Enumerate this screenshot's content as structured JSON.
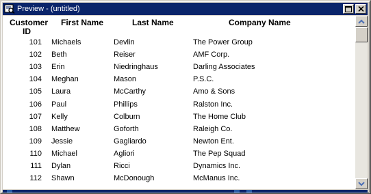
{
  "window": {
    "title": "Preview - (untitled)",
    "app_icon": "preview-icon",
    "buttons": [
      {
        "name": "restore-button",
        "icon": "restore-icon"
      },
      {
        "name": "close-button",
        "icon": "close-icon"
      }
    ]
  },
  "columns": {
    "customer_id": "Customer ID",
    "first_name": "First Name",
    "last_name": "Last Name",
    "company_name": "Company Name"
  },
  "rows": [
    {
      "id": "101",
      "first": "Michaels",
      "last": "Devlin",
      "company": "The Power Group"
    },
    {
      "id": "102",
      "first": "Beth",
      "last": "Reiser",
      "company": "AMF Corp."
    },
    {
      "id": "103",
      "first": "Erin",
      "last": "Niedringhaus",
      "company": "Darling Associates"
    },
    {
      "id": "104",
      "first": "Meghan",
      "last": "Mason",
      "company": "P.S.C."
    },
    {
      "id": "105",
      "first": "Laura",
      "last": "McCarthy",
      "company": "Amo & Sons"
    },
    {
      "id": "106",
      "first": "Paul",
      "last": "Phillips",
      "company": "Ralston Inc."
    },
    {
      "id": "107",
      "first": "Kelly",
      "last": "Colburn",
      "company": "The Home Club"
    },
    {
      "id": "108",
      "first": "Matthew",
      "last": "Goforth",
      "company": "Raleigh Co."
    },
    {
      "id": "109",
      "first": "Jessie",
      "last": "Gagliardo",
      "company": "Newton Ent."
    },
    {
      "id": "110",
      "first": "Michael",
      "last": "Agliori",
      "company": "The Pep Squad"
    },
    {
      "id": "111",
      "first": "Dylan",
      "last": "Ricci",
      "company": "Dynamics Inc."
    },
    {
      "id": "112",
      "first": "Shawn",
      "last": "McDonough",
      "company": "McManus Inc."
    }
  ],
  "colors": {
    "titlebar": "#0a246a",
    "face": "#d4d0c8",
    "scroll_arrow": "#4a6eb5"
  }
}
